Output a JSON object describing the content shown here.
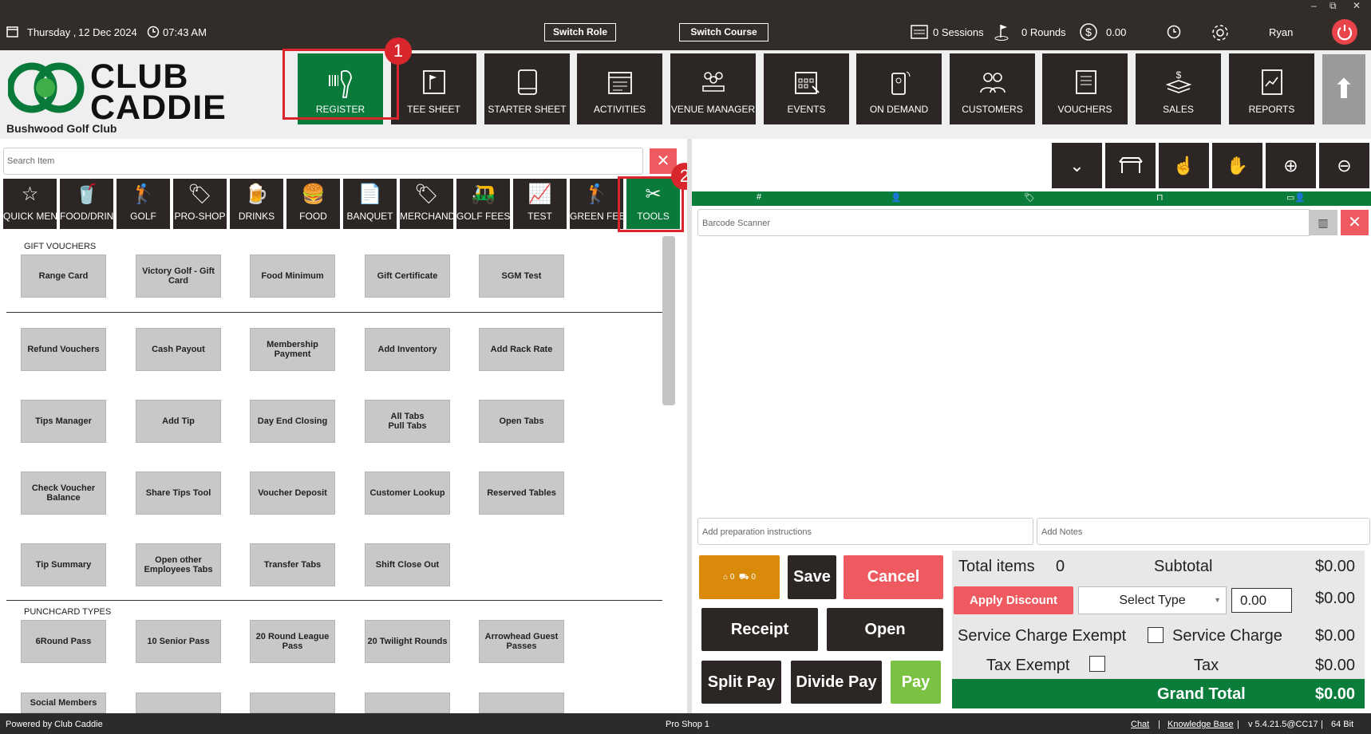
{
  "topbar": {
    "day": "Thursday ,",
    "date": "12 Dec 2024",
    "time": "07:43 AM",
    "switch_role": "Switch Role",
    "switch_course": "Switch Course",
    "sessions": "0 Sessions",
    "rounds": "0 Rounds",
    "amount": "0.00",
    "user": "Ryan",
    "win_min": "–",
    "win_restore": "⧉",
    "win_close": "✕"
  },
  "header": {
    "logo_line1": "CLUB",
    "logo_line2": "CADDIE",
    "club_name": "Bushwood Golf Club",
    "nav": [
      {
        "label": "REGISTER"
      },
      {
        "label": "TEE SHEET"
      },
      {
        "label": "STARTER SHEET"
      },
      {
        "label": "ACTIVITIES"
      },
      {
        "label": "VENUE MANAGER"
      },
      {
        "label": "EVENTS"
      },
      {
        "label": "ON DEMAND"
      },
      {
        "label": "CUSTOMERS"
      },
      {
        "label": "VOUCHERS"
      },
      {
        "label": "SALES"
      },
      {
        "label": "REPORTS"
      }
    ],
    "badge1": "1",
    "badge2": "2"
  },
  "left": {
    "search_placeholder": "Search Item",
    "categories": [
      {
        "label": "QUICK MENU",
        "icon": "star-icon"
      },
      {
        "label": "FOOD/DRINK",
        "icon": "food-drink-icon"
      },
      {
        "label": "GOLF",
        "icon": "golfer-icon"
      },
      {
        "label": "PRO-SHOP",
        "icon": "pro-shop-icon"
      },
      {
        "label": "DRINKS",
        "icon": "beer-icon"
      },
      {
        "label": "FOOD",
        "icon": "burger-icon"
      },
      {
        "label": "BANQUET",
        "icon": "document-icon"
      },
      {
        "label": "MERCHANDISE",
        "icon": "merch-icon"
      },
      {
        "label": "GOLF FEES",
        "icon": "golf-cart-icon"
      },
      {
        "label": "TEST",
        "icon": "chart-icon"
      },
      {
        "label": "GREEN FEES",
        "icon": "golfer-icon"
      },
      {
        "label": "TOOLS",
        "icon": "tools-icon"
      }
    ],
    "section_gift": "GIFT VOUCHERS",
    "section_punch": "PUNCHCARD TYPES",
    "gift_items": [
      "Range Card",
      "Victory Golf - Gift Card",
      "Food Minimum",
      "Gift Certificate",
      "SGM Test"
    ],
    "tool_rows": [
      [
        "Refund Vouchers",
        "Cash Payout",
        "Membership Payment",
        "Add Inventory",
        "Add Rack Rate"
      ],
      [
        "Tips Manager",
        "Add Tip",
        "Day End Closing",
        "All Tabs\nPull Tabs",
        "Open Tabs"
      ],
      [
        "Check Voucher Balance",
        "Share Tips Tool",
        "Voucher Deposit",
        "Customer Lookup",
        "Reserved Tables"
      ],
      [
        "Tip Summary",
        "Open other Employees Tabs",
        "Transfer Tabs",
        "Shift Close Out"
      ]
    ],
    "punch_items": [
      "6Round Pass",
      "10 Senior Pass",
      "20 Round League Pass",
      "20 Twilight Rounds",
      "Arrowhead Guest Passes"
    ],
    "partial_items": [
      "Social Members"
    ]
  },
  "right": {
    "col_hash": "#",
    "barcode_placeholder": "Barcode Scanner",
    "prep_placeholder": "Add preparation instructions",
    "notes_placeholder": "Add Notes",
    "tab_counts": "0",
    "tab_counts2": "0",
    "buttons": {
      "save": "Save",
      "cancel": "Cancel",
      "receipt": "Receipt",
      "open": "Open",
      "split_pay": "Split Pay",
      "divide_pay": "Divide Pay",
      "pay": "Pay",
      "apply_discount": "Apply Discount"
    },
    "totals": {
      "total_items_label": "Total items",
      "total_items": "0",
      "subtotal_label": "Subtotal",
      "subtotal": "$0.00",
      "select_type": "Select Type",
      "discount_value": "0.00",
      "discount_amount": "$0.00",
      "sc_exempt": "Service Charge Exempt",
      "service_charge_label": "Service Charge",
      "service_charge": "$0.00",
      "tax_exempt": "Tax Exempt",
      "tax_label": "Tax",
      "tax": "$0.00",
      "grand_total_label": "Grand Total",
      "grand_total": "$0.00"
    }
  },
  "footer": {
    "powered": "Powered by Club Caddie",
    "station": "Pro Shop 1",
    "chat": "Chat",
    "sep": "|",
    "kb": "Knowledge Base",
    "version": "v 5.4.21.5@CC17",
    "bits": "64 Bit"
  },
  "colors": {
    "dark": "#322d29",
    "green": "#0a7a3a",
    "red": "#e8444a",
    "orange": "#d98a0b",
    "pay_green": "#7cc242",
    "highlight": "#d9262c"
  }
}
